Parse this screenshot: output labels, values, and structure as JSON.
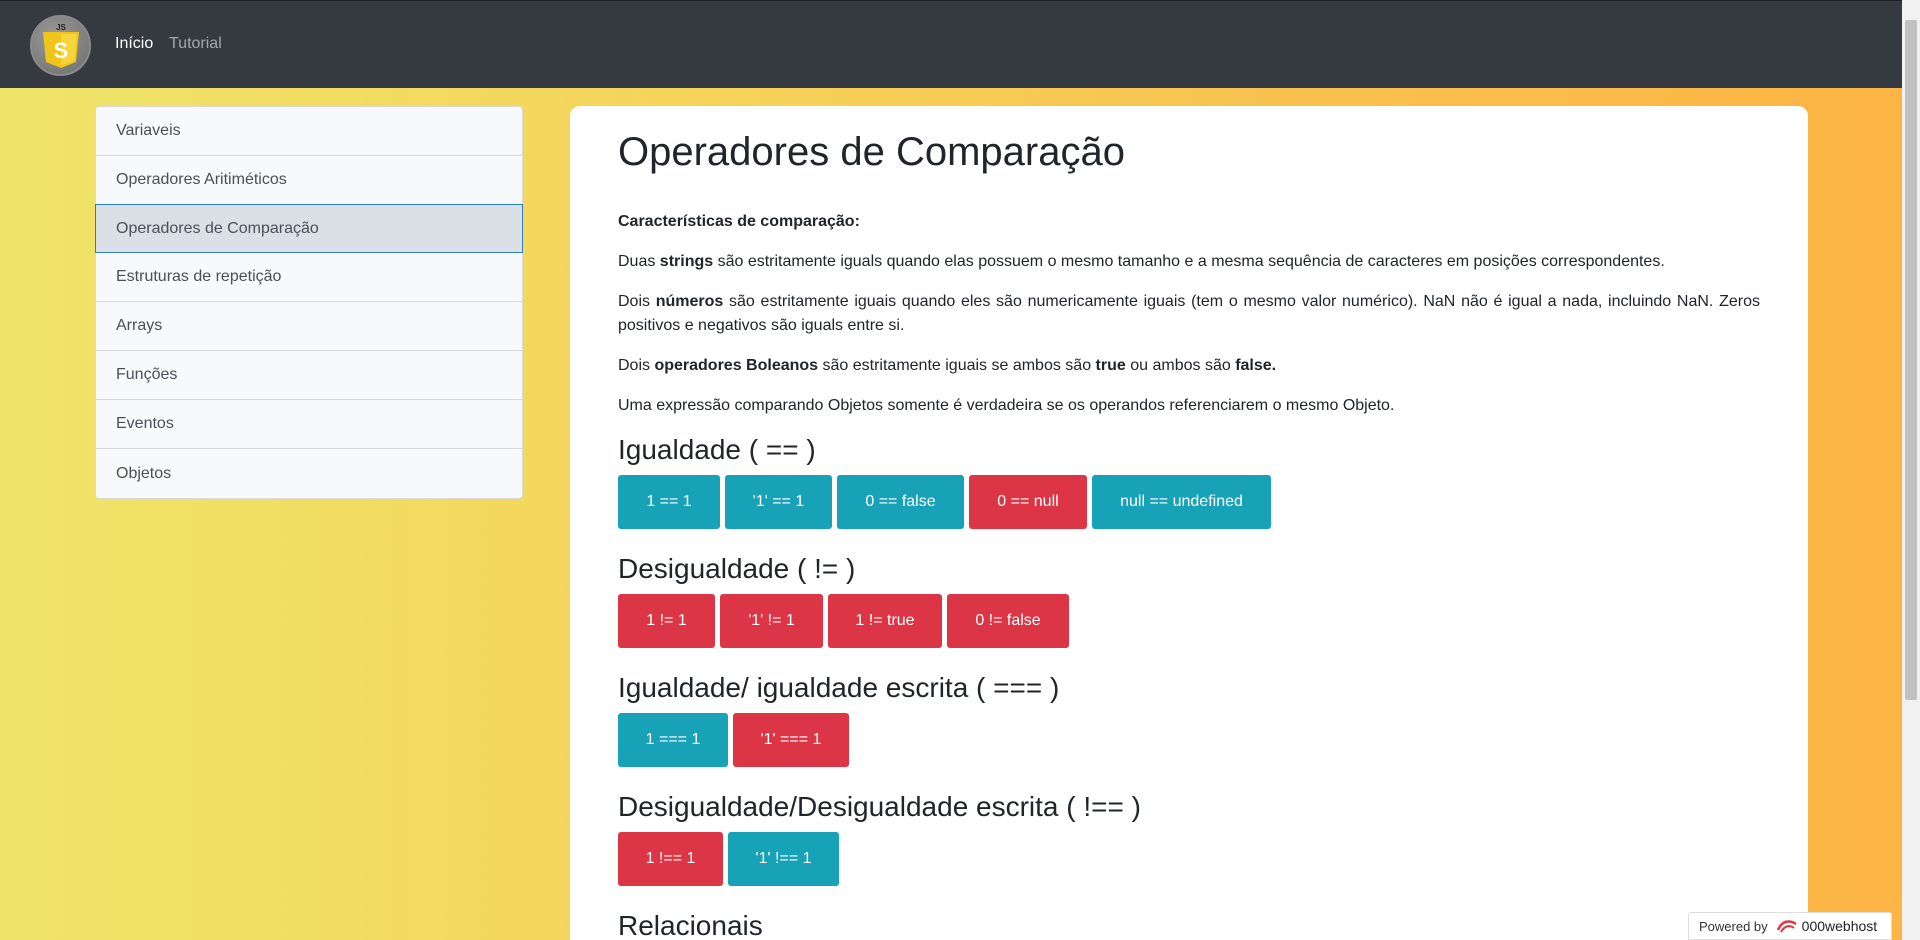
{
  "nav": {
    "logo_text": "JS",
    "items": [
      {
        "label": "Início"
      },
      {
        "label": "Tutorial"
      }
    ]
  },
  "sidebar": {
    "items": [
      {
        "label": "Variaveis"
      },
      {
        "label": "Operadores Aritiméticos"
      },
      {
        "label": "Operadores de Comparação"
      },
      {
        "label": "Estruturas de repetição"
      },
      {
        "label": "Arrays"
      },
      {
        "label": "Funções"
      },
      {
        "label": "Eventos"
      },
      {
        "label": "Objetos"
      }
    ]
  },
  "main": {
    "title": "Operadores de Comparação",
    "characteristics_heading": "Características de comparação:",
    "p1": {
      "a": "Duas ",
      "b": "strings",
      "c": " são estritamente iguals quando elas possuem o mesmo tamanho e a mesma sequência de caracteres em posições correspondentes."
    },
    "p2": {
      "a": "Dois ",
      "b": "números",
      "c": " são estritamente iguais quando eles são numericamente iguais (tem o mesmo valor numérico). NaN não é igual a nada, incluindo NaN. Zeros positivos e negativos são iguals entre si."
    },
    "p3": {
      "a": "Dois ",
      "b": "operadores Boleanos",
      "c": " são estritamente iguais se ambos são ",
      "d": "true",
      "e": " ou ambos são ",
      "f": "false."
    },
    "p4": "Uma expressão comparando Objetos somente é verdadeira se os operandos referenciarem o mesmo Objeto.",
    "sections": [
      {
        "heading": "Igualdade ( == )",
        "buttons": [
          "1 == 1",
          "'1' == 1",
          "0 == false",
          "0 == null",
          "null == undefined"
        ]
      },
      {
        "heading": "Desigualdade ( != )",
        "buttons": [
          "1 != 1",
          "'1' != 1",
          "1 != true",
          "0 != false"
        ]
      },
      {
        "heading": "Igualdade/ igualdade escrita ( === )",
        "buttons": [
          "1 === 1",
          "'1' === 1"
        ]
      },
      {
        "heading": "Desigualdade/Desigualdade escrita ( !== )",
        "buttons": [
          "1 !== 1",
          "'1' !== 1"
        ]
      },
      {
        "heading": "Relacionais"
      }
    ]
  },
  "footer": {
    "powered_by": "Powered by",
    "brand": "000webhost"
  },
  "colors": {
    "info": "#17a2b8",
    "danger": "#dc3545",
    "navbar": "#343a40"
  }
}
